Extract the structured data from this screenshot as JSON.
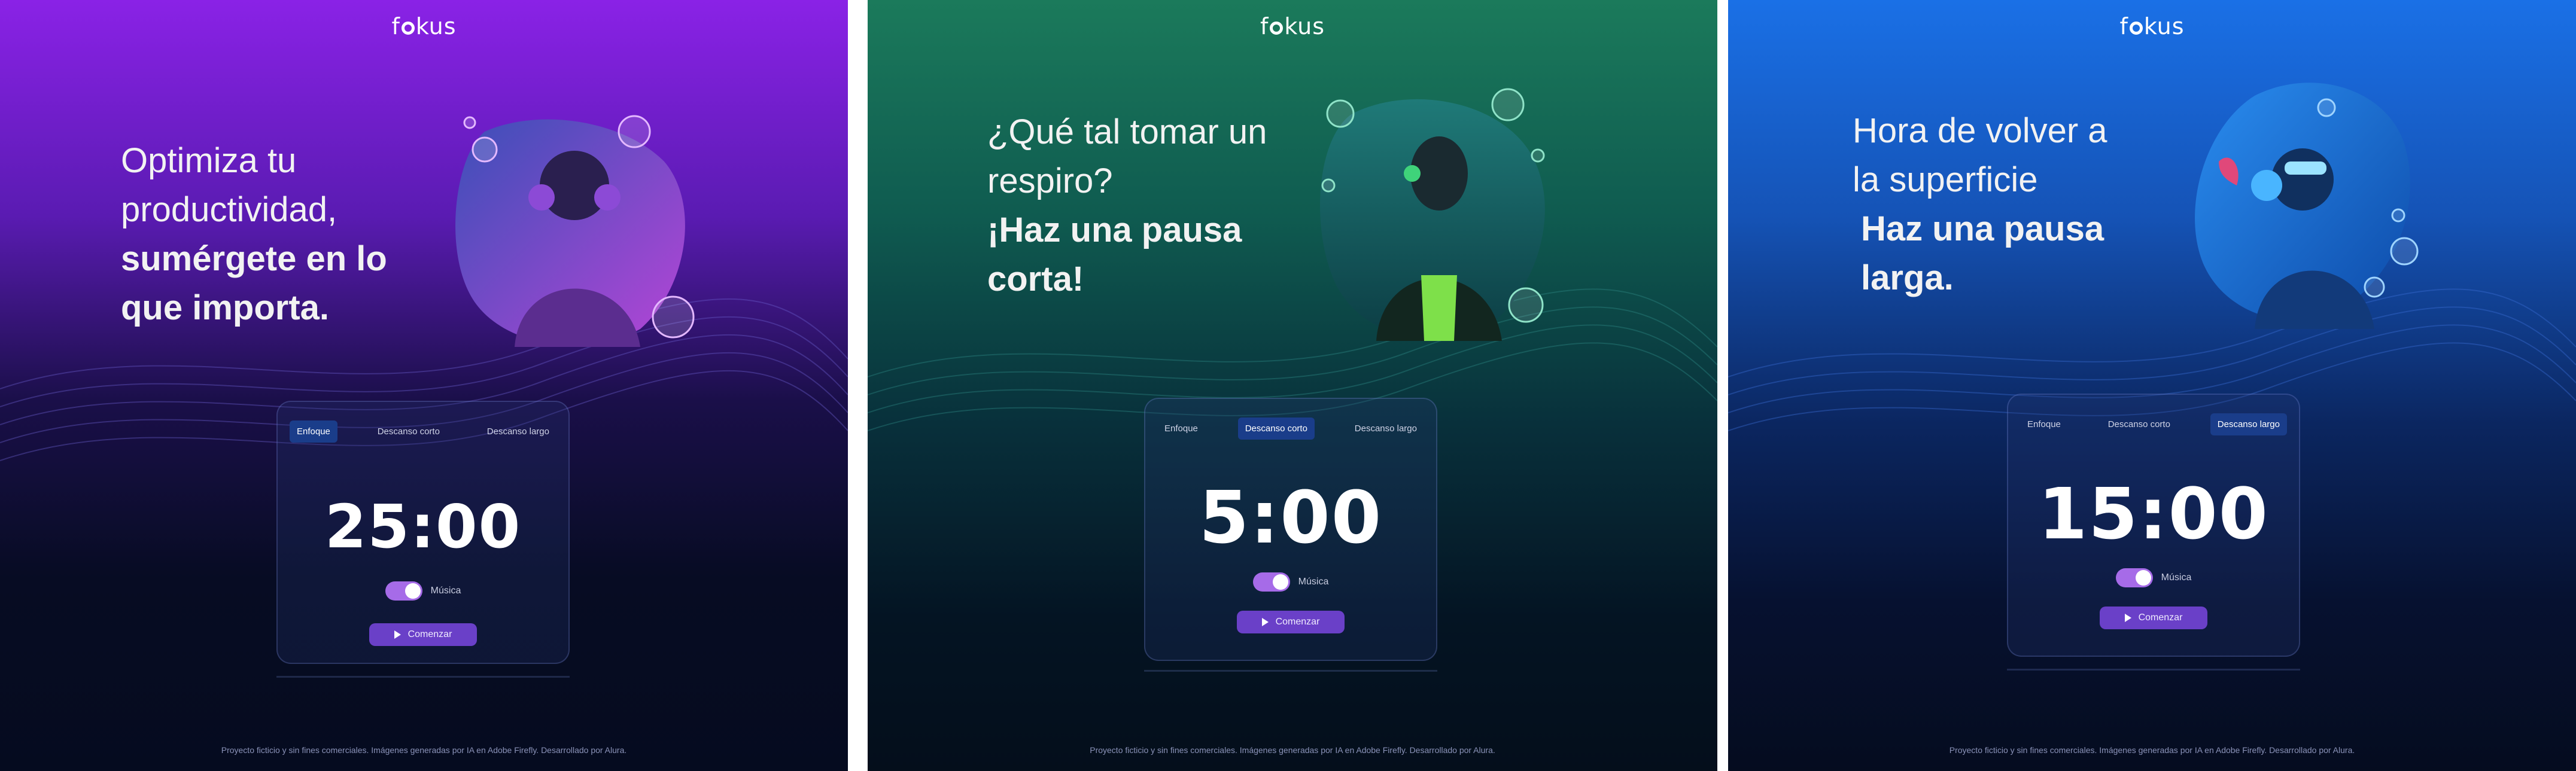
{
  "app": {
    "logo_text": "fokus"
  },
  "panels": [
    {
      "headline_light": "Optimiza tu productividad,",
      "headline_bold": "sumérgete en lo que importa.",
      "tabs": [
        "Enfoque",
        "Descanso corto",
        "Descanso largo"
      ],
      "active_tab": "Enfoque",
      "time": "25:00",
      "music_label": "Música",
      "music_enabled": true,
      "start_label": "Comenzar",
      "footer": "Proyecto ficticio y sin fines comerciales. Imágenes generadas por IA en Adobe Firefly. Desarrollado por Alura.",
      "accent": "#8a22e6"
    },
    {
      "headline_light": "¿Qué tal tomar un respiro?",
      "headline_bold": "¡Haz una pausa corta!",
      "tabs": [
        "Enfoque",
        "Descanso corto",
        "Descanso largo"
      ],
      "active_tab": "Descanso corto",
      "time": "5:00",
      "music_label": "Música",
      "music_enabled": true,
      "start_label": "Comenzar",
      "footer": "Proyecto ficticio y sin fines comerciales. Imágenes generadas por IA en Adobe Firefly. Desarrollado por Alura.",
      "accent": "#1b7a5b"
    },
    {
      "headline_light": "Hora de volver a la superficie",
      "headline_bold": "Haz una pausa larga.",
      "tabs": [
        "Enfoque",
        "Descanso corto",
        "Descanso largo"
      ],
      "active_tab": "Descanso largo",
      "time": "15:00",
      "music_label": "Música",
      "music_enabled": true,
      "start_label": "Comenzar",
      "footer": "Proyecto ficticio y sin fines comerciales. Imágenes generadas por IA en Adobe Firefly. Desarrollado por Alura.",
      "accent": "#1a70e6"
    }
  ],
  "colors": {
    "active_tab_bg": "#1a3d8a",
    "toggle_on": "#a66be8",
    "start_button": "#6a40c8"
  },
  "icons": [
    "play-icon",
    "bubble-icon"
  ]
}
